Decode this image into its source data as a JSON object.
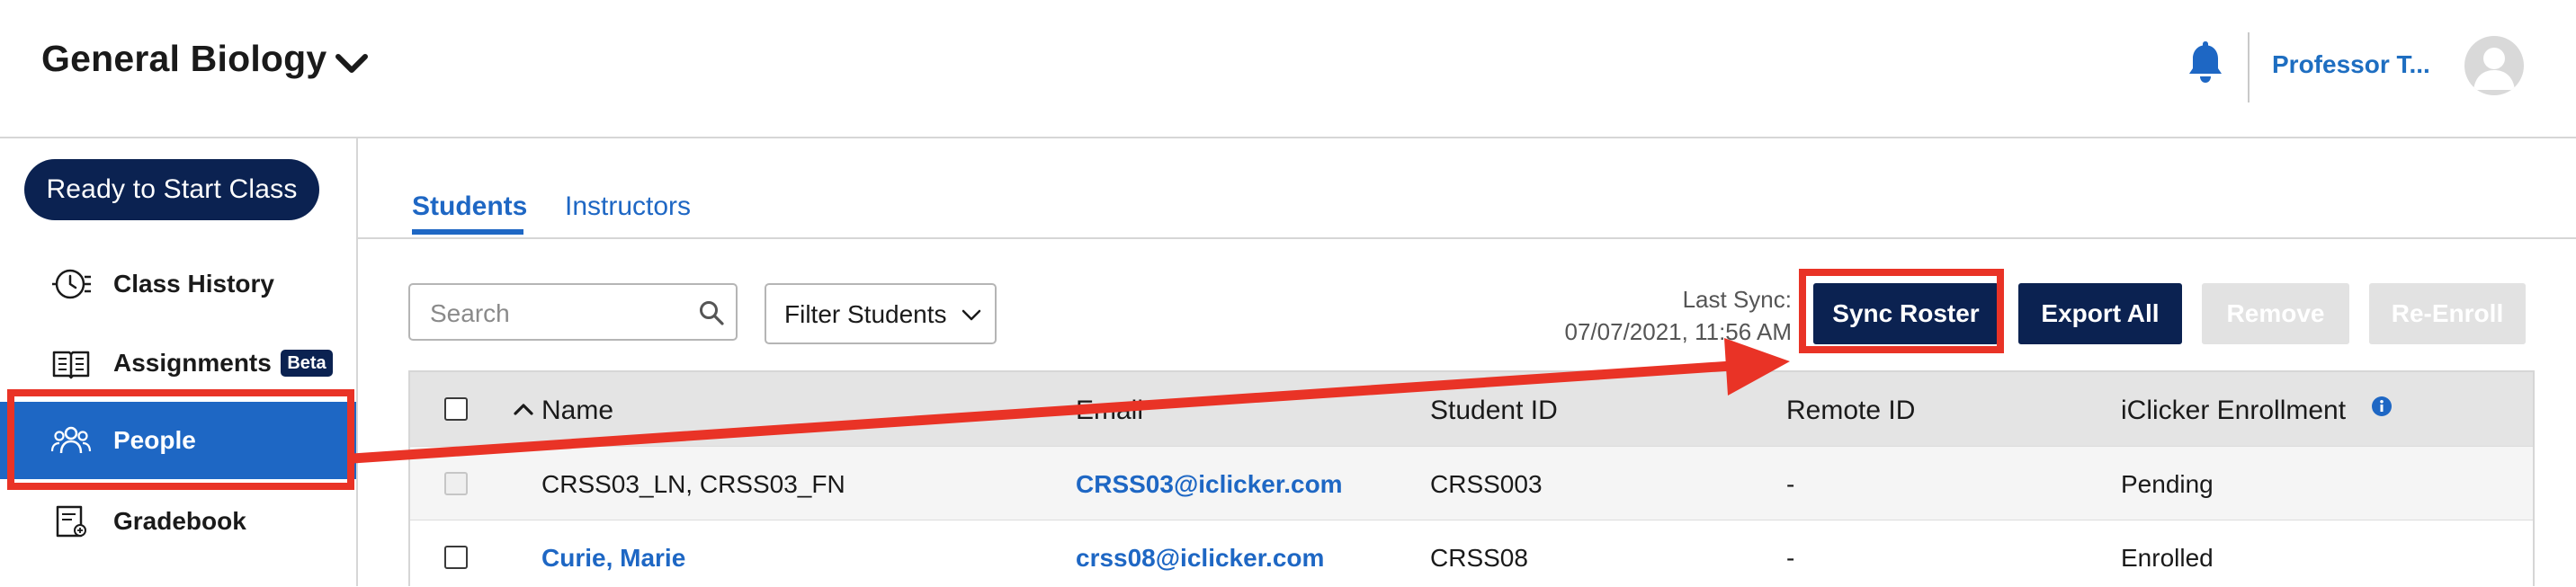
{
  "header": {
    "course_title": "General Biology",
    "user_name": "Professor T...",
    "icons": {
      "course": "chevron-down-icon",
      "notifications": "bell-icon",
      "avatar": "user-avatar-icon"
    }
  },
  "sidebar": {
    "start_button": "Ready to Start Class",
    "items": [
      {
        "label": "Class History",
        "icon": "class-history-icon"
      },
      {
        "label": "Assignments",
        "icon": "assignments-icon",
        "badge": "Beta"
      },
      {
        "label": "People",
        "icon": "people-icon",
        "active": true
      },
      {
        "label": "Gradebook",
        "icon": "gradebook-icon"
      }
    ]
  },
  "tabs": [
    {
      "label": "Students",
      "active": true
    },
    {
      "label": "Instructors",
      "active": false
    }
  ],
  "toolbar": {
    "search_placeholder": "Search",
    "search_value": "",
    "filter_label": "Filter Students",
    "last_sync_label": "Last Sync:",
    "last_sync_time": "07/07/2021, 11:56 AM",
    "buttons": {
      "sync": "Sync Roster",
      "export": "Export All",
      "remove": "Remove",
      "reenroll": "Re-Enroll"
    }
  },
  "table": {
    "columns": [
      "Name",
      "Email",
      "Student ID",
      "Remote ID",
      "iClicker Enrollment"
    ],
    "sort_column": "Name",
    "rows": [
      {
        "name": "CRSS03_LN, CRSS03_FN",
        "email": "CRSS03@iclicker.com",
        "student_id": "CRSS003",
        "remote_id": "-",
        "enrollment": "Pending"
      },
      {
        "name": "Curie, Marie",
        "email": "crss08@iclicker.com",
        "student_id": "CRSS08",
        "remote_id": "-",
        "enrollment": "Enrolled"
      }
    ]
  },
  "colors": {
    "navy": "#0b2251",
    "accent_blue": "#1e67c4",
    "annotation_red": "#e93326",
    "disabled": "#e2e2e2"
  }
}
